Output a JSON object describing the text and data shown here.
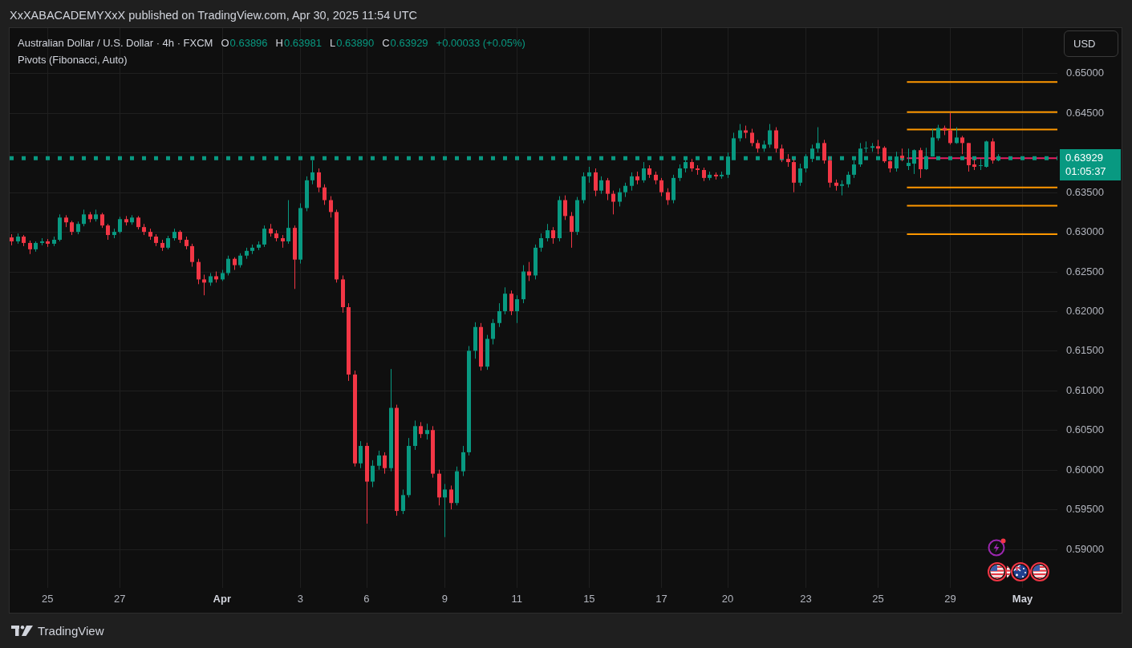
{
  "attribution": "XxXABACADEMYXxX published on TradingView.com, Apr 30, 2025 11:54 UTC",
  "chart": {
    "legend": {
      "symbol": "Australian Dollar / U.S. Dollar · 4h · FXCM",
      "rising": true,
      "ohlc": [
        {
          "label": "O",
          "value": "0.63896"
        },
        {
          "label": "H",
          "value": "0.63981"
        },
        {
          "label": "L",
          "value": "0.63890"
        },
        {
          "label": "C",
          "value": "0.63929"
        }
      ],
      "change": "+0.00033 (+0.05%)"
    },
    "indicators": [
      {
        "label": "Pivots (Fibonacci, Auto)"
      }
    ],
    "price_scale": {
      "currency": "USD",
      "last_price": "0.63929",
      "countdown": "01:05:37"
    },
    "chart_data": {
      "type": "candlestick",
      "grid": true,
      "ylim": [
        0.5851,
        0.6557
      ],
      "yticks": [
        {
          "value": 0.65,
          "label": "0.65000"
        },
        {
          "value": 0.645,
          "label": "0.64500"
        },
        {
          "value": 0.635,
          "label": "0.63500"
        },
        {
          "value": 0.63,
          "label": "0.63000"
        },
        {
          "value": 0.625,
          "label": "0.62500"
        },
        {
          "value": 0.62,
          "label": "0.62000"
        },
        {
          "value": 0.615,
          "label": "0.61500"
        },
        {
          "value": 0.61,
          "label": "0.61000"
        },
        {
          "value": 0.605,
          "label": "0.60500"
        },
        {
          "value": 0.6,
          "label": "0.60000"
        },
        {
          "value": 0.595,
          "label": "0.59500"
        },
        {
          "value": 0.59,
          "label": "0.59000"
        }
      ],
      "categories": [
        null,
        null,
        null,
        null,
        null,
        null,
        "25",
        null,
        null,
        null,
        null,
        null,
        null,
        null,
        null,
        null,
        null,
        null,
        "27",
        null,
        null,
        null,
        null,
        null,
        null,
        null,
        null,
        null,
        null,
        null,
        null,
        null,
        null,
        null,
        null,
        "Apr",
        null,
        null,
        null,
        null,
        null,
        null,
        null,
        null,
        null,
        null,
        null,
        null,
        "3",
        null,
        null,
        null,
        null,
        null,
        null,
        null,
        null,
        null,
        null,
        "6",
        null,
        null,
        null,
        null,
        null,
        null,
        null,
        null,
        null,
        null,
        null,
        null,
        "9",
        null,
        null,
        null,
        null,
        null,
        null,
        null,
        null,
        null,
        null,
        null,
        "11",
        null,
        null,
        null,
        null,
        null,
        null,
        null,
        null,
        null,
        null,
        null,
        "15",
        null,
        null,
        null,
        null,
        null,
        null,
        null,
        null,
        null,
        null,
        null,
        "17",
        null,
        null,
        null,
        null,
        null,
        null,
        null,
        null,
        null,
        null,
        "20",
        null,
        null,
        null,
        null,
        null,
        null,
        null,
        null,
        null,
        null,
        null,
        null,
        "23",
        null,
        null,
        null,
        null,
        null,
        null,
        null,
        null,
        null,
        null,
        null,
        "25",
        null,
        null,
        null,
        null,
        null,
        null,
        null,
        null,
        null,
        null,
        null,
        "29",
        null,
        null,
        null,
        null,
        null,
        null,
        null,
        null,
        null,
        null,
        null,
        "May",
        null,
        null,
        null,
        null,
        null
      ],
      "ohlc": [
        [
          0.6293,
          0.6297,
          0.6283,
          0.6288
        ],
        [
          0.6288,
          0.6298,
          0.6285,
          0.6294
        ],
        [
          0.6294,
          0.6296,
          0.6282,
          0.6286
        ],
        [
          0.6286,
          0.6289,
          0.6272,
          0.6278
        ],
        [
          0.6278,
          0.6288,
          0.6275,
          0.6286
        ],
        [
          0.6286,
          0.6292,
          0.6283,
          0.6288
        ],
        [
          0.6288,
          0.6291,
          0.6281,
          0.6285
        ],
        [
          0.6285,
          0.6294,
          0.6282,
          0.629
        ],
        [
          0.629,
          0.6322,
          0.6288,
          0.6318
        ],
        [
          0.6318,
          0.6321,
          0.6306,
          0.6312
        ],
        [
          0.6312,
          0.6314,
          0.6296,
          0.63
        ],
        [
          0.63,
          0.6313,
          0.6297,
          0.631
        ],
        [
          0.631,
          0.6328,
          0.6307,
          0.6322
        ],
        [
          0.6322,
          0.6325,
          0.6312,
          0.6316
        ],
        [
          0.6316,
          0.6328,
          0.6313,
          0.6322
        ],
        [
          0.6322,
          0.6324,
          0.6305,
          0.6308
        ],
        [
          0.6308,
          0.631,
          0.629,
          0.6296
        ],
        [
          0.6296,
          0.6304,
          0.6292,
          0.63
        ],
        [
          0.63,
          0.6319,
          0.6298,
          0.6316
        ],
        [
          0.6316,
          0.632,
          0.6308,
          0.6312
        ],
        [
          0.6312,
          0.6321,
          0.6309,
          0.6318
        ],
        [
          0.6318,
          0.632,
          0.6303,
          0.6306
        ],
        [
          0.6306,
          0.631,
          0.6296,
          0.63
        ],
        [
          0.63,
          0.6304,
          0.629,
          0.6294
        ],
        [
          0.6294,
          0.6297,
          0.6282,
          0.6286
        ],
        [
          0.6286,
          0.629,
          0.6276,
          0.628
        ],
        [
          0.628,
          0.6295,
          0.6278,
          0.6292
        ],
        [
          0.6292,
          0.6304,
          0.6289,
          0.63
        ],
        [
          0.63,
          0.6302,
          0.6286,
          0.629
        ],
        [
          0.629,
          0.6294,
          0.6278,
          0.6282
        ],
        [
          0.6282,
          0.6285,
          0.6256,
          0.6262
        ],
        [
          0.6262,
          0.6266,
          0.6234,
          0.624
        ],
        [
          0.624,
          0.6246,
          0.622,
          0.6236
        ],
        [
          0.6236,
          0.6248,
          0.6232,
          0.6244
        ],
        [
          0.6244,
          0.625,
          0.6236,
          0.624
        ],
        [
          0.624,
          0.6252,
          0.6238,
          0.6248
        ],
        [
          0.6248,
          0.627,
          0.6245,
          0.6266
        ],
        [
          0.6266,
          0.6268,
          0.6252,
          0.6258
        ],
        [
          0.6258,
          0.6273,
          0.6255,
          0.627
        ],
        [
          0.627,
          0.628,
          0.6266,
          0.6276
        ],
        [
          0.6276,
          0.6284,
          0.6272,
          0.628
        ],
        [
          0.628,
          0.6288,
          0.6277,
          0.6284
        ],
        [
          0.6284,
          0.6308,
          0.6281,
          0.6304
        ],
        [
          0.6304,
          0.631,
          0.6294,
          0.6298
        ],
        [
          0.6298,
          0.6302,
          0.6288,
          0.6292
        ],
        [
          0.6292,
          0.6296,
          0.628,
          0.6288
        ],
        [
          0.6288,
          0.634,
          0.6285,
          0.6305
        ],
        [
          0.6305,
          0.6308,
          0.6228,
          0.6265
        ],
        [
          0.6265,
          0.6336,
          0.626,
          0.633
        ],
        [
          0.633,
          0.637,
          0.6326,
          0.6365
        ],
        [
          0.6365,
          0.639,
          0.636,
          0.6375
        ],
        [
          0.6375,
          0.638,
          0.635,
          0.6356
        ],
        [
          0.6356,
          0.636,
          0.6334,
          0.634
        ],
        [
          0.634,
          0.6345,
          0.6318,
          0.6325
        ],
        [
          0.6325,
          0.6328,
          0.6236,
          0.624
        ],
        [
          0.624,
          0.6245,
          0.6198,
          0.6205
        ],
        [
          0.6205,
          0.621,
          0.6112,
          0.612
        ],
        [
          0.612,
          0.6125,
          0.6004,
          0.6008
        ],
        [
          0.6008,
          0.6036,
          0.6002,
          0.603
        ],
        [
          0.603,
          0.6034,
          0.5932,
          0.5985
        ],
        [
          0.5985,
          0.6012,
          0.5978,
          0.6005
        ],
        [
          0.6005,
          0.6024,
          0.6,
          0.6018
        ],
        [
          0.6018,
          0.6022,
          0.5995,
          0.6002
        ],
        [
          0.6002,
          0.6127,
          0.5998,
          0.6078
        ],
        [
          0.6078,
          0.6082,
          0.5942,
          0.5948
        ],
        [
          0.5948,
          0.5975,
          0.5944,
          0.5968
        ],
        [
          0.5968,
          0.604,
          0.5965,
          0.603
        ],
        [
          0.603,
          0.6062,
          0.6025,
          0.6055
        ],
        [
          0.6055,
          0.606,
          0.604,
          0.6045
        ],
        [
          0.6045,
          0.6058,
          0.6038,
          0.605
        ],
        [
          0.605,
          0.6055,
          0.599,
          0.5995
        ],
        [
          0.5995,
          0.6,
          0.5955,
          0.5965
        ],
        [
          0.5965,
          0.5982,
          0.5915,
          0.5975
        ],
        [
          0.5975,
          0.598,
          0.595,
          0.5958
        ],
        [
          0.5958,
          0.6004,
          0.5955,
          0.5998
        ],
        [
          0.5998,
          0.603,
          0.5992,
          0.6022
        ],
        [
          0.6022,
          0.6156,
          0.6018,
          0.615
        ],
        [
          0.615,
          0.6186,
          0.614,
          0.618
        ],
        [
          0.618,
          0.6185,
          0.6125,
          0.613
        ],
        [
          0.613,
          0.617,
          0.6126,
          0.6165
        ],
        [
          0.6165,
          0.619,
          0.6158,
          0.6185
        ],
        [
          0.6185,
          0.621,
          0.618,
          0.62
        ],
        [
          0.62,
          0.623,
          0.6196,
          0.6222
        ],
        [
          0.6222,
          0.6226,
          0.6195,
          0.62
        ],
        [
          0.62,
          0.622,
          0.6185,
          0.6215
        ],
        [
          0.6215,
          0.6258,
          0.621,
          0.625
        ],
        [
          0.625,
          0.6262,
          0.6238,
          0.6245
        ],
        [
          0.6245,
          0.6284,
          0.624,
          0.628
        ],
        [
          0.628,
          0.6298,
          0.6275,
          0.6292
        ],
        [
          0.6292,
          0.631,
          0.6288,
          0.6302
        ],
        [
          0.6302,
          0.6306,
          0.6285,
          0.6292
        ],
        [
          0.6292,
          0.6345,
          0.6288,
          0.634
        ],
        [
          0.634,
          0.6346,
          0.6315,
          0.632
        ],
        [
          0.632,
          0.6325,
          0.628,
          0.63
        ],
        [
          0.63,
          0.6344,
          0.6296,
          0.634
        ],
        [
          0.634,
          0.6375,
          0.6336,
          0.637
        ],
        [
          0.637,
          0.6382,
          0.6362,
          0.6375
        ],
        [
          0.6375,
          0.638,
          0.6345,
          0.6352
        ],
        [
          0.6352,
          0.637,
          0.6348,
          0.6365
        ],
        [
          0.6365,
          0.6368,
          0.634,
          0.6348
        ],
        [
          0.6348,
          0.6352,
          0.6322,
          0.6338
        ],
        [
          0.6338,
          0.6355,
          0.6332,
          0.635
        ],
        [
          0.635,
          0.6362,
          0.6344,
          0.6358
        ],
        [
          0.6358,
          0.6375,
          0.6352,
          0.637
        ],
        [
          0.637,
          0.6376,
          0.636,
          0.6365
        ],
        [
          0.6365,
          0.6388,
          0.6362,
          0.638
        ],
        [
          0.638,
          0.6384,
          0.6368,
          0.6372
        ],
        [
          0.6372,
          0.6376,
          0.636,
          0.6365
        ],
        [
          0.6365,
          0.6368,
          0.6345,
          0.635
        ],
        [
          0.635,
          0.6355,
          0.6334,
          0.634
        ],
        [
          0.634,
          0.6372,
          0.6336,
          0.6368
        ],
        [
          0.6368,
          0.6385,
          0.6364,
          0.638
        ],
        [
          0.638,
          0.6394,
          0.6375,
          0.6388
        ],
        [
          0.6388,
          0.6392,
          0.6376,
          0.638
        ],
        [
          0.638,
          0.6384,
          0.6372,
          0.6378
        ],
        [
          0.6378,
          0.6381,
          0.6364,
          0.6368
        ],
        [
          0.6368,
          0.6376,
          0.6365,
          0.6372
        ],
        [
          0.6372,
          0.6375,
          0.6366,
          0.637
        ],
        [
          0.637,
          0.6376,
          0.6367,
          0.6372
        ],
        [
          0.6372,
          0.64,
          0.6368,
          0.6395
        ],
        [
          0.6395,
          0.6425,
          0.6392,
          0.6418
        ],
        [
          0.6418,
          0.6436,
          0.6414,
          0.6428
        ],
        [
          0.6428,
          0.6434,
          0.6418,
          0.6425
        ],
        [
          0.6425,
          0.643,
          0.6408,
          0.6412
        ],
        [
          0.6412,
          0.6416,
          0.64,
          0.6405
        ],
        [
          0.6405,
          0.6415,
          0.6401,
          0.641
        ],
        [
          0.641,
          0.6436,
          0.6406,
          0.6428
        ],
        [
          0.6428,
          0.6432,
          0.64,
          0.6405
        ],
        [
          0.6405,
          0.641,
          0.6388,
          0.6392
        ],
        [
          0.6392,
          0.6398,
          0.6382,
          0.6388
        ],
        [
          0.6388,
          0.6392,
          0.635,
          0.6362
        ],
        [
          0.6362,
          0.6386,
          0.6358,
          0.638
        ],
        [
          0.638,
          0.6398,
          0.6375,
          0.6392
        ],
        [
          0.6392,
          0.641,
          0.6388,
          0.6405
        ],
        [
          0.6405,
          0.6432,
          0.64,
          0.6412
        ],
        [
          0.6412,
          0.6416,
          0.6386,
          0.639
        ],
        [
          0.639,
          0.6395,
          0.6356,
          0.6362
        ],
        [
          0.6362,
          0.6366,
          0.6352,
          0.6358
        ],
        [
          0.6358,
          0.6365,
          0.6346,
          0.636
        ],
        [
          0.636,
          0.6376,
          0.6356,
          0.6372
        ],
        [
          0.6372,
          0.639,
          0.6368,
          0.6385
        ],
        [
          0.6385,
          0.6412,
          0.6382,
          0.6405
        ],
        [
          0.6405,
          0.6414,
          0.64,
          0.6406
        ],
        [
          0.6406,
          0.6412,
          0.6401,
          0.6408
        ],
        [
          0.6408,
          0.6416,
          0.6398,
          0.6405
        ],
        [
          0.6406,
          0.6408,
          0.6387,
          0.6389
        ],
        [
          0.6389,
          0.639,
          0.6375,
          0.638
        ],
        [
          0.638,
          0.6401,
          0.6376,
          0.6395
        ],
        [
          0.6396,
          0.6405,
          0.6389,
          0.6393
        ],
        [
          0.6383,
          0.6405,
          0.6378,
          0.6387
        ],
        [
          0.6386,
          0.6404,
          0.6373,
          0.6403
        ],
        [
          0.6403,
          0.6406,
          0.6368,
          0.6379
        ],
        [
          0.6379,
          0.6406,
          0.6378,
          0.6395
        ],
        [
          0.6395,
          0.643,
          0.6395,
          0.6419
        ],
        [
          0.6418,
          0.6435,
          0.6415,
          0.6431
        ],
        [
          0.6431,
          0.6434,
          0.6422,
          0.6428
        ],
        [
          0.6428,
          0.645,
          0.641,
          0.6412
        ],
        [
          0.6412,
          0.6432,
          0.6411,
          0.6419
        ],
        [
          0.6419,
          0.6421,
          0.6398,
          0.6412
        ],
        [
          0.6412,
          0.6412,
          0.6376,
          0.6384
        ],
        [
          0.6385,
          0.6392,
          0.6378,
          0.6382
        ],
        [
          0.6383,
          0.6392,
          0.6378,
          0.6384
        ],
        [
          0.6382,
          0.6415,
          0.6381,
          0.6414
        ],
        [
          0.6414,
          0.6418,
          0.6386,
          0.639
        ],
        [
          0.639,
          0.6398,
          0.6389,
          0.6393
        ],
        null,
        null,
        null,
        null,
        null,
        null,
        null,
        null,
        null
      ],
      "ref_lines": [
        {
          "axis": "y",
          "value": 0.6393,
          "color": "#089981"
        },
        {
          "axis": "y",
          "value": 0.6489,
          "color": "#ff9800"
        },
        {
          "axis": "y",
          "value": 0.6451,
          "color": "#ff9800"
        },
        {
          "axis": "y",
          "value": 0.6429,
          "color": "#ff9800"
        },
        {
          "axis": "y",
          "value": 0.6393,
          "color": "#e91e63"
        },
        {
          "axis": "y",
          "value": 0.6356,
          "color": "#ff9800"
        },
        {
          "axis": "y",
          "value": 0.6333,
          "color": "#ff9800"
        },
        {
          "axis": "y",
          "value": 0.6297,
          "color": "#ff9800"
        }
      ]
    }
  },
  "footer": {
    "brand": "TradingView"
  }
}
